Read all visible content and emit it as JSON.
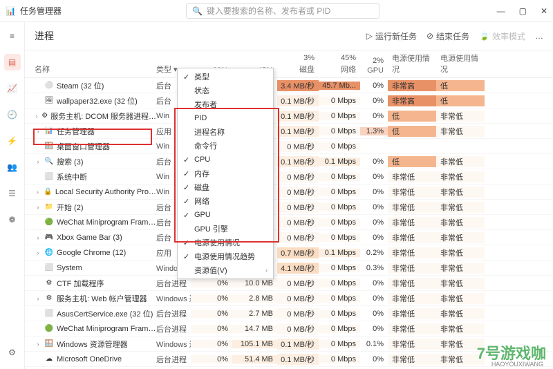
{
  "app_title": "任务管理器",
  "search_placeholder": "键入要搜索的名称、发布者或 PID",
  "page_title": "进程",
  "header_buttons": {
    "run_new": "运行新任务",
    "end_task": "结束任务",
    "eff_mode": "效率模式"
  },
  "columns": {
    "name": "名称",
    "type": "类型",
    "cpu_pct": "32%",
    "cpu": "",
    "mem_pct": "45%",
    "mem": "",
    "disk_pct": "3%",
    "disk": "磁盘",
    "net_pct": "45%",
    "net": "网络",
    "gpu_pct": "2%",
    "gpu": "GPU",
    "pwr": "电源使用情况",
    "pwrt": "电源使用情况"
  },
  "context_menu": [
    {
      "check": true,
      "label": "类型"
    },
    {
      "check": false,
      "label": "状态"
    },
    {
      "check": false,
      "label": "发布者"
    },
    {
      "check": false,
      "label": "PID"
    },
    {
      "check": false,
      "label": "进程名称"
    },
    {
      "check": false,
      "label": "命令行"
    },
    {
      "check": true,
      "label": "CPU"
    },
    {
      "check": true,
      "label": "内存"
    },
    {
      "check": true,
      "label": "磁盘"
    },
    {
      "check": true,
      "label": "网络"
    },
    {
      "check": true,
      "label": "GPU"
    },
    {
      "check": false,
      "label": "GPU 引擎"
    },
    {
      "check": true,
      "label": "电源使用情况"
    },
    {
      "check": true,
      "label": "电源使用情况趋势"
    },
    {
      "check": false,
      "label": "资源值(V)",
      "submenu": true
    }
  ],
  "rows": [
    {
      "expand": "",
      "icon": "⚪",
      "name": "Steam (32 位)",
      "type": "后台",
      "cpu": "",
      "mem": "",
      "disk": "3.4 MB/秒",
      "net": "45.7 Mb...",
      "gpu": "0%",
      "pwr": "非常高",
      "pwrt": "低",
      "dh": 4,
      "nh": 4,
      "ph": 4,
      "pth": 3
    },
    {
      "expand": "",
      "icon": "🖼",
      "name": "wallpaper32.exe (32 位)",
      "type": "后台",
      "cpu": "",
      "mem": "",
      "disk": "0.1 MB/秒",
      "net": "0 Mbps",
      "gpu": "0%",
      "pwr": "非常高",
      "pwrt": "低",
      "dh": 1,
      "nh": 0,
      "ph": 4,
      "pth": 3
    },
    {
      "expand": "›",
      "icon": "⚙",
      "name": "服务主机: DCOM 服务器进程…",
      "type": "Win",
      "cpu": "",
      "mem": "",
      "disk": "0.1 MB/秒",
      "net": "0 Mbps",
      "gpu": "0%",
      "pwr": "低",
      "pwrt": "非常低",
      "dh": 1,
      "nh": 0,
      "ph": 3,
      "pth": 0
    },
    {
      "expand": "›",
      "icon": "📊",
      "name": "任务管理器",
      "type": "应用",
      "cpu": "",
      "mem": "",
      "disk": "0.1 MB/秒",
      "net": "0 Mbps",
      "gpu": "1.3%",
      "pwr": "低",
      "pwrt": "非常低",
      "dh": 1,
      "nh": 0,
      "ph": 3,
      "pth": 0,
      "gh": 5
    },
    {
      "expand": "",
      "icon": "🪟",
      "name": "桌面窗口管理器",
      "type": "Win",
      "cpu": "",
      "mem": "",
      "disk": "0 MB/秒",
      "net": "0 Mbps",
      "gpu": "",
      "pwr": "",
      "pwrt": "",
      "dh": 0,
      "nh": 0
    },
    {
      "expand": "›",
      "icon": "🔍",
      "name": "搜索 (3)",
      "type": "后台",
      "cpu": "",
      "mem": "",
      "disk": "0.1 MB/秒",
      "net": "0.1 Mbps",
      "gpu": "0%",
      "pwr": "低",
      "pwrt": "非常低",
      "dh": 1,
      "nh": 1,
      "ph": 3,
      "pth": 0
    },
    {
      "expand": "",
      "icon": "⬜",
      "name": "系统中断",
      "type": "Win",
      "cpu": "",
      "mem": "",
      "disk": "0 MB/秒",
      "net": "0 Mbps",
      "gpu": "0%",
      "pwr": "非常低",
      "pwrt": "非常低",
      "dh": 0,
      "nh": 0,
      "ph": 0,
      "pth": 0
    },
    {
      "expand": "›",
      "icon": "🔒",
      "name": "Local Security Authority Pro…",
      "type": "Win",
      "cpu": "",
      "mem": "",
      "disk": "0 MB/秒",
      "net": "0 Mbps",
      "gpu": "0%",
      "pwr": "非常低",
      "pwrt": "非常低",
      "dh": 0,
      "nh": 0,
      "ph": 0,
      "pth": 0
    },
    {
      "expand": "›",
      "icon": "📁",
      "name": "开始 (2)",
      "type": "后台",
      "cpu": "",
      "mem": "",
      "disk": "0 MB/秒",
      "net": "0 Mbps",
      "gpu": "0%",
      "pwr": "非常低",
      "pwrt": "非常低",
      "dh": 0,
      "nh": 0,
      "ph": 0,
      "pth": 0
    },
    {
      "expand": "",
      "icon": "🟢",
      "name": "WeChat Miniprogram Fram…",
      "type": "后台",
      "cpu": "",
      "mem": "",
      "disk": "0 MB/秒",
      "net": "0 Mbps",
      "gpu": "0%",
      "pwr": "非常低",
      "pwrt": "非常低",
      "dh": 0,
      "nh": 0,
      "ph": 0,
      "pth": 0
    },
    {
      "expand": "›",
      "icon": "🎮",
      "name": "Xbox Game Bar (3)",
      "type": "后台",
      "cpu": "",
      "mem": "",
      "disk": "0 MB/秒",
      "net": "0 Mbps",
      "gpu": "0%",
      "pwr": "非常低",
      "pwrt": "非常低",
      "dh": 0,
      "nh": 0,
      "ph": 0,
      "pth": 0
    },
    {
      "expand": "›",
      "icon": "🌐",
      "name": "Google Chrome (12)",
      "type": "应用",
      "cpu": "",
      "mem": "",
      "disk": "0.7 MB/秒",
      "net": "0.1 Mbps",
      "gpu": "0.2%",
      "pwr": "非常低",
      "pwrt": "非常低",
      "dh": 2,
      "nh": 1,
      "ph": 0,
      "pth": 0
    },
    {
      "expand": "",
      "icon": "⬜",
      "name": "System",
      "type": "Windows 进程",
      "cpu": "0%",
      "mem": "",
      "disk": "4.1 MB/秒",
      "net": "0 Mbps",
      "gpu": "0.3%",
      "pwr": "非常低",
      "pwrt": "非常低",
      "ch": 0,
      "dh": 2,
      "nh": 0,
      "ph": 0,
      "pth": 0
    },
    {
      "expand": "",
      "icon": "⚙",
      "name": "CTF 加载程序",
      "type": "后台进程",
      "cpu": "0%",
      "mem": "10.0 MB",
      "disk": "0 MB/秒",
      "net": "0 Mbps",
      "gpu": "0%",
      "pwr": "非常低",
      "pwrt": "非常低",
      "ch": 0,
      "mh": 0,
      "dh": 0,
      "nh": 0,
      "ph": 0,
      "pth": 0
    },
    {
      "expand": "›",
      "icon": "⚙",
      "name": "服务主机: Web 帐户管理器",
      "type": "Windows 进程",
      "cpu": "0%",
      "mem": "2.8 MB",
      "disk": "0 MB/秒",
      "net": "0 Mbps",
      "gpu": "0%",
      "pwr": "非常低",
      "pwrt": "非常低",
      "ch": 0,
      "mh": 0,
      "dh": 0,
      "nh": 0,
      "ph": 0,
      "pth": 0
    },
    {
      "expand": "",
      "icon": "⬜",
      "name": "AsusCertService.exe (32 位)",
      "type": "后台进程",
      "cpu": "0%",
      "mem": "2.7 MB",
      "disk": "0 MB/秒",
      "net": "0 Mbps",
      "gpu": "0%",
      "pwr": "非常低",
      "pwrt": "非常低",
      "ch": 0,
      "mh": 0,
      "dh": 0,
      "nh": 0,
      "ph": 0,
      "pth": 0
    },
    {
      "expand": "",
      "icon": "🟢",
      "name": "WeChat Miniprogram Fram…",
      "type": "后台进程",
      "cpu": "0%",
      "mem": "14.7 MB",
      "disk": "0 MB/秒",
      "net": "0 Mbps",
      "gpu": "0%",
      "pwr": "非常低",
      "pwrt": "非常低",
      "ch": 0,
      "mh": 0,
      "dh": 0,
      "nh": 0,
      "ph": 0,
      "pth": 0
    },
    {
      "expand": "›",
      "icon": "🪟",
      "name": "Windows 资源管理器",
      "type": "Windows 进程",
      "cpu": "0%",
      "mem": "105.1 MB",
      "disk": "0.1 MB/秒",
      "net": "0 Mbps",
      "gpu": "0.1%",
      "pwr": "非常低",
      "pwrt": "非常低",
      "ch": 0,
      "mh": 1,
      "dh": 1,
      "nh": 0,
      "ph": 0,
      "pth": 0
    },
    {
      "expand": "",
      "icon": "☁",
      "name": "Microsoft OneDrive",
      "type": "后台进程",
      "cpu": "0%",
      "mem": "51.4 MB",
      "disk": "0.1 MB/秒",
      "net": "0 Mbps",
      "gpu": "0%",
      "pwr": "非常低",
      "pwrt": "非常低",
      "ch": 0,
      "mh": 1,
      "dh": 1,
      "nh": 0,
      "ph": 0,
      "pth": 0
    }
  ],
  "watermark": "7号游戏咖",
  "watermark_sub": "HAOYOUXIWANG"
}
